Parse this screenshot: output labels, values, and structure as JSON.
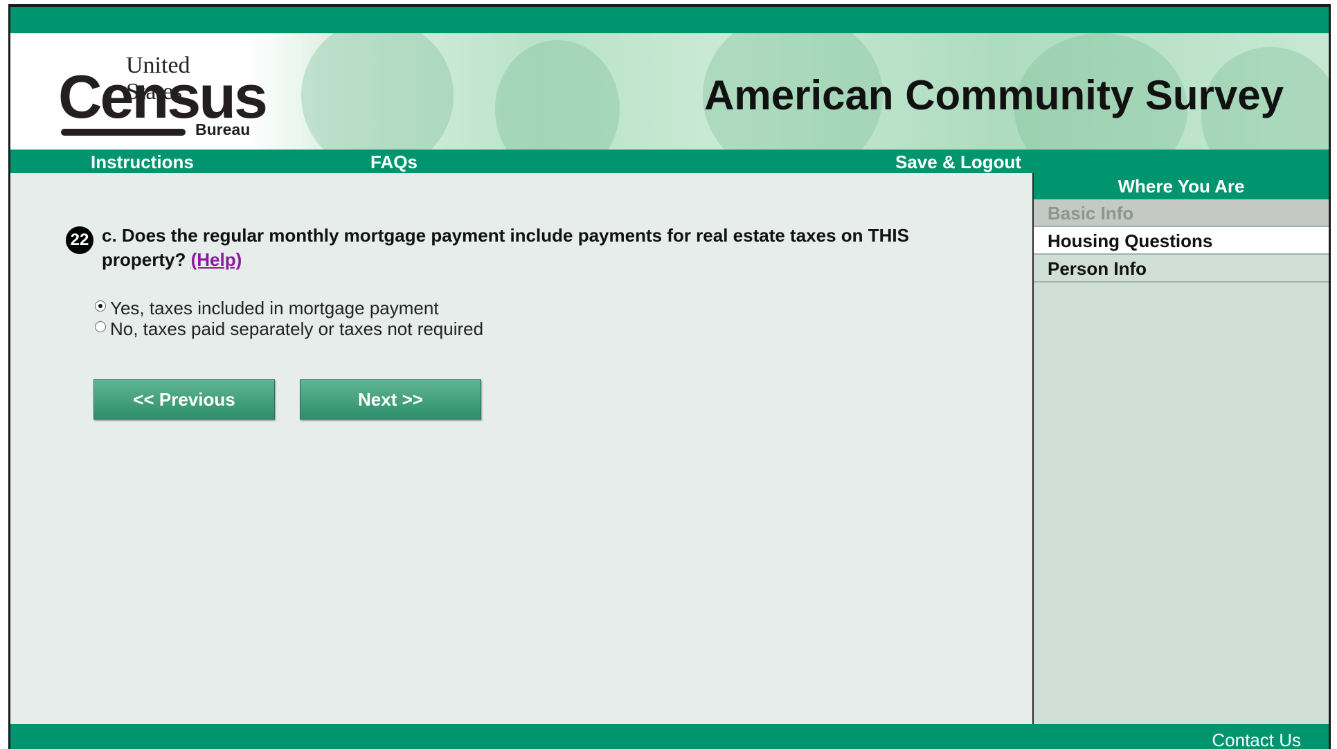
{
  "header": {
    "logo": {
      "line1": "United States",
      "tm": "™",
      "line2": "Census",
      "line3": "Bureau"
    },
    "title": "American Community Survey"
  },
  "nav": {
    "instructions": "Instructions",
    "faqs": "FAQs",
    "save_logout": "Save & Logout"
  },
  "question": {
    "number": "22",
    "text": "c. Does the regular monthly mortgage payment include payments for real estate taxes on THIS property?",
    "help_label": "(Help)",
    "options": [
      {
        "label": "Yes, taxes included in mortgage payment",
        "selected": true
      },
      {
        "label": "No, taxes paid separately or taxes not required",
        "selected": false
      }
    ]
  },
  "buttons": {
    "previous": "<<   Previous",
    "next": "Next   >>"
  },
  "sidebar": {
    "heading": "Where You Are",
    "items": [
      {
        "label": "Basic Info",
        "state": "completed"
      },
      {
        "label": "Housing Questions",
        "state": "current"
      },
      {
        "label": "Person Info",
        "state": "upcoming"
      }
    ]
  },
  "footer": {
    "contact": "Contact Us"
  },
  "colors": {
    "brand_green": "#00956f",
    "help_link": "#8b1a9e",
    "panel_bg": "#e7edea"
  }
}
